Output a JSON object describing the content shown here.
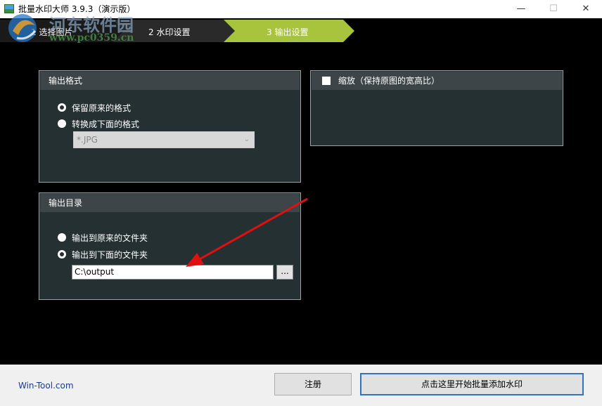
{
  "window": {
    "title": "批量水印大师 3.9.3（演示版）",
    "controls": {
      "minimize": "—",
      "maximize": "☐",
      "close": "✕"
    }
  },
  "watermark": {
    "text": "河东软件园",
    "url": "www.pc0359.cn"
  },
  "steps": [
    {
      "label": "1 选择图片",
      "active": false
    },
    {
      "label": "2 水印设置",
      "active": false
    },
    {
      "label": "3 输出设置",
      "active": true
    }
  ],
  "output_format": {
    "title": "输出格式",
    "options": [
      {
        "label": "保留原来的格式",
        "checked": true
      },
      {
        "label": "转换成下面的格式",
        "checked": false
      }
    ],
    "format_value": "*.JPG"
  },
  "resize": {
    "label": "缩放（保持原图的宽高比）",
    "checked": false
  },
  "output_dir": {
    "title": "输出目录",
    "options": [
      {
        "label": "输出到原来的文件夹",
        "checked": false
      },
      {
        "label": "输出到下面的文件夹",
        "checked": true
      }
    ],
    "path_value": "C:\\output",
    "browse_label": "..."
  },
  "footer": {
    "brand": "Win-Tool.com",
    "register_label": "注册",
    "start_label": "点击这里开始批量添加水印"
  },
  "colors": {
    "panel_bg": "#253033",
    "panel_header": "#3d4548",
    "step_active": "#a8c43c",
    "step_inactive": "#2a2a2a",
    "arrow": "#e01010",
    "accent_border": "#2e74c0"
  }
}
